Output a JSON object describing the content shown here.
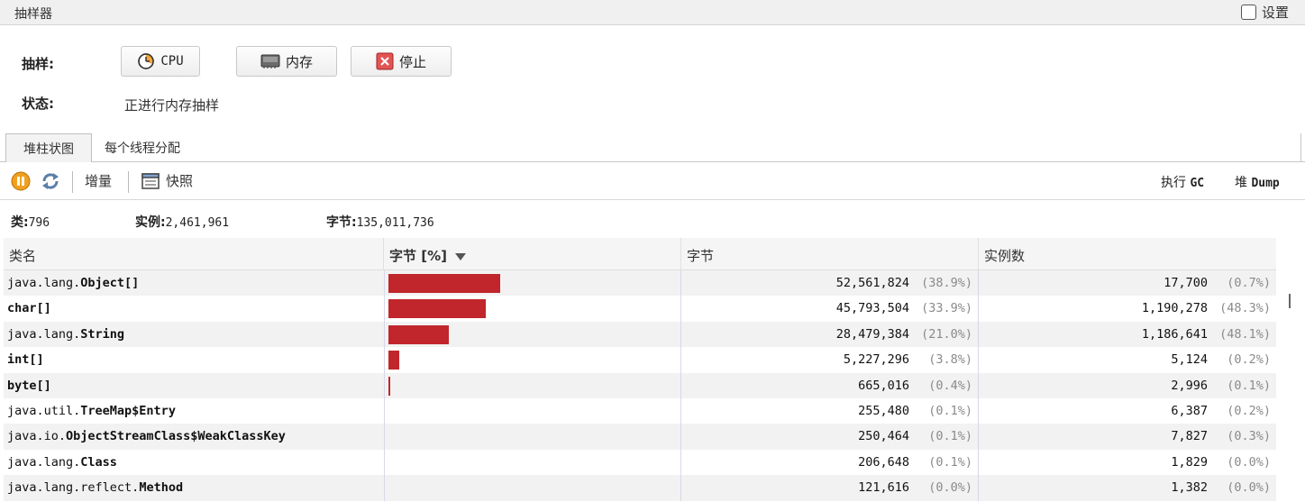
{
  "window": {
    "title": "抽样器",
    "settings_label": "设置"
  },
  "sampling": {
    "label": "抽样:",
    "cpu_label": "CPU",
    "memory_label": "内存",
    "stop_label": "停止",
    "status_label": "状态:",
    "status_value": "正进行内存抽样"
  },
  "tabs": [
    {
      "label": "堆柱状图",
      "active": true
    },
    {
      "label": "每个线程分配",
      "active": false
    }
  ],
  "toolbar": {
    "delta_label": "增量",
    "snapshot_label": "快照",
    "gc_prefix": "执行",
    "gc_label": "GC",
    "heap_prefix": "堆",
    "heap_label": "Dump",
    "pause_icon": "pause-icon",
    "refresh_icon": "refresh-icon"
  },
  "summary": {
    "classes_label": "类:",
    "classes_value": "796",
    "instances_label": "实例:",
    "instances_value": "2,461,961",
    "bytes_label": "字节:",
    "bytes_value": "135,011,736"
  },
  "columns": {
    "name": "类名",
    "bytes_pct": "字节 [%]",
    "bytes": "字节",
    "instances": "实例数"
  },
  "colors": {
    "bar": "#c0262c"
  },
  "rows": [
    {
      "pkg": "java.lang.",
      "cls": "Object[]",
      "bytes_pct": 38.9,
      "bytes": "52,561,824",
      "bytes_p": "(38.9%)",
      "inst": "17,700",
      "inst_p": "(0.7%)"
    },
    {
      "pkg": "",
      "cls": "char[]",
      "bytes_pct": 33.9,
      "bytes": "45,793,504",
      "bytes_p": "(33.9%)",
      "inst": "1,190,278",
      "inst_p": "(48.3%)"
    },
    {
      "pkg": "java.lang.",
      "cls": "String",
      "bytes_pct": 21.0,
      "bytes": "28,479,384",
      "bytes_p": "(21.0%)",
      "inst": "1,186,641",
      "inst_p": "(48.1%)"
    },
    {
      "pkg": "",
      "cls": "int[]",
      "bytes_pct": 3.8,
      "bytes": "5,227,296",
      "bytes_p": "(3.8%)",
      "inst": "5,124",
      "inst_p": "(0.2%)"
    },
    {
      "pkg": "",
      "cls": "byte[]",
      "bytes_pct": 0.4,
      "bytes": "665,016",
      "bytes_p": "(0.4%)",
      "inst": "2,996",
      "inst_p": "(0.1%)"
    },
    {
      "pkg": "java.util.",
      "cls": "TreeMap$Entry",
      "bytes_pct": 0.1,
      "bytes": "255,480",
      "bytes_p": "(0.1%)",
      "inst": "6,387",
      "inst_p": "(0.2%)"
    },
    {
      "pkg": "java.io.",
      "cls": "ObjectStreamClass$WeakClassKey",
      "bytes_pct": 0.1,
      "bytes": "250,464",
      "bytes_p": "(0.1%)",
      "inst": "7,827",
      "inst_p": "(0.3%)"
    },
    {
      "pkg": "java.lang.",
      "cls": "Class",
      "bytes_pct": 0.1,
      "bytes": "206,648",
      "bytes_p": "(0.1%)",
      "inst": "1,829",
      "inst_p": "(0.0%)"
    },
    {
      "pkg": "java.lang.reflect.",
      "cls": "Method",
      "bytes_pct": 0.0,
      "bytes": "121,616",
      "bytes_p": "(0.0%)",
      "inst": "1,382",
      "inst_p": "(0.0%)"
    }
  ]
}
